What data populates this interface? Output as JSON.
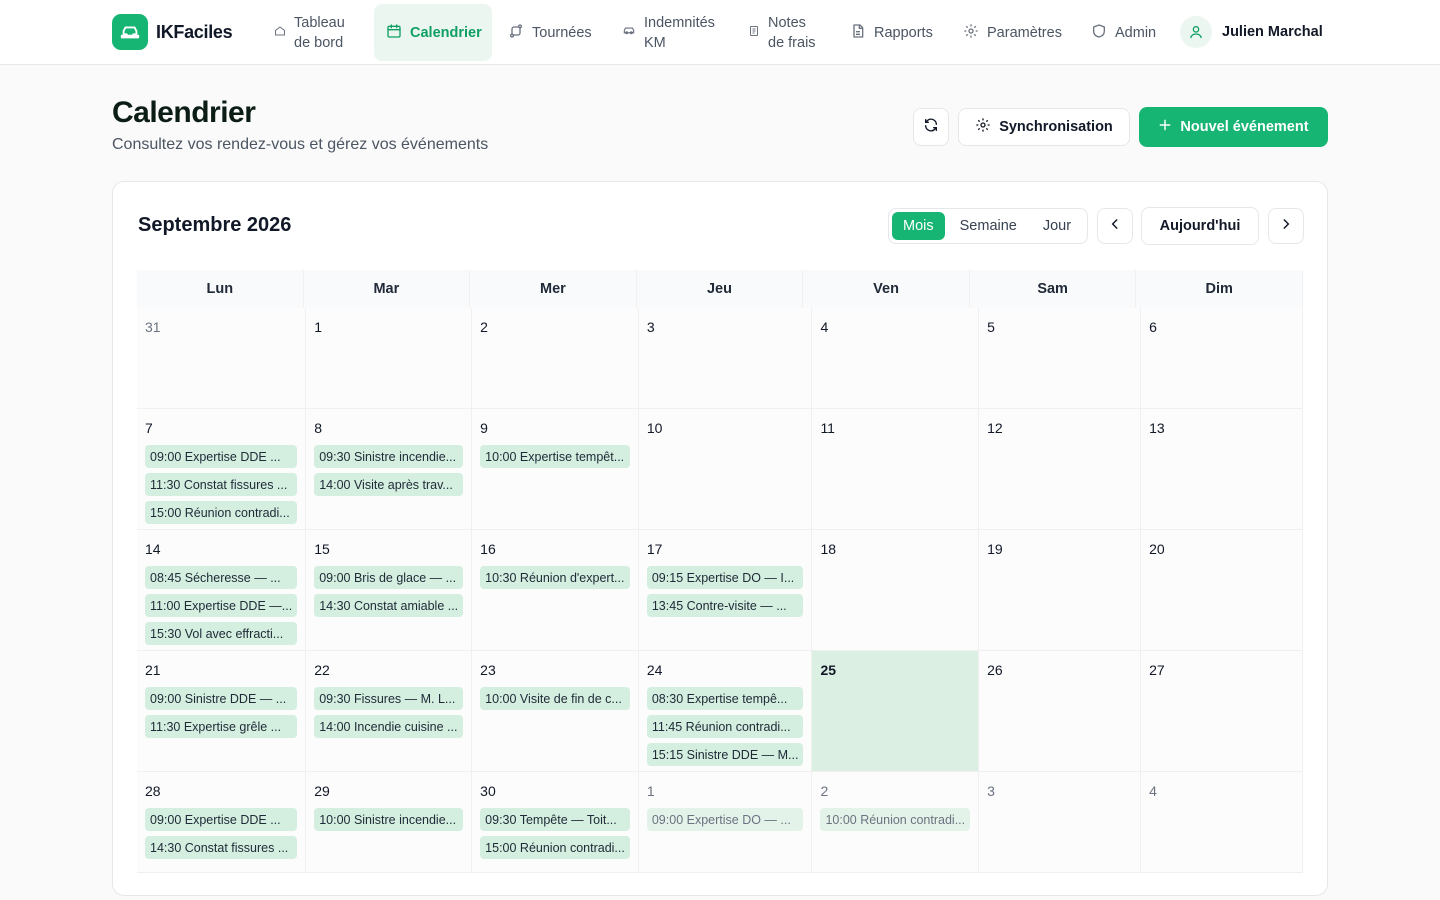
{
  "app": {
    "name": "IKFaciles",
    "brand_color": "#16b574"
  },
  "nav": {
    "items": [
      {
        "label": "Tableau\nde bord",
        "icon": "home-icon"
      },
      {
        "label": "Calendrier",
        "icon": "calendar-icon",
        "active": true
      },
      {
        "label": "Tournées",
        "icon": "route-icon"
      },
      {
        "label": "Indemnités\nKM",
        "icon": "car-icon"
      },
      {
        "label": "Notes\nde frais",
        "icon": "receipt-icon"
      },
      {
        "label": "Rapports",
        "icon": "file-icon"
      },
      {
        "label": "Paramètres",
        "icon": "gear-icon"
      },
      {
        "label": "Admin",
        "icon": "shield-icon"
      }
    ],
    "user_name": "Julien Marchal"
  },
  "header": {
    "title": "Calendrier",
    "subtitle": "Consultez vos rendez-vous et gérez vos événements",
    "sync_label": "Synchronisation",
    "new_event_label": "Nouvel événement"
  },
  "calendar": {
    "month_label": "Septembre 2026",
    "views": [
      "Mois",
      "Semaine",
      "Jour"
    ],
    "active_view": "Mois",
    "today_label": "Aujourd'hui",
    "weekdays": [
      "Lun",
      "Mar",
      "Mer",
      "Jeu",
      "Ven",
      "Sam",
      "Dim"
    ],
    "weeks": [
      [
        {
          "day": "31",
          "outside": true,
          "events": []
        },
        {
          "day": "1",
          "events": []
        },
        {
          "day": "2",
          "events": []
        },
        {
          "day": "3",
          "events": []
        },
        {
          "day": "4",
          "events": []
        },
        {
          "day": "5",
          "events": []
        },
        {
          "day": "6",
          "events": []
        }
      ],
      [
        {
          "day": "7",
          "events": [
            "09:00 Expertise DDE ...",
            "11:30 Constat fissures ...",
            "15:00 Réunion contradi..."
          ]
        },
        {
          "day": "8",
          "events": [
            "09:30 Sinistre incendie...",
            "14:00 Visite après trav..."
          ]
        },
        {
          "day": "9",
          "events": [
            "10:00 Expertise tempêt..."
          ]
        },
        {
          "day": "10",
          "events": []
        },
        {
          "day": "11",
          "events": []
        },
        {
          "day": "12",
          "events": []
        },
        {
          "day": "13",
          "events": []
        }
      ],
      [
        {
          "day": "14",
          "events": [
            "08:45 Sécheresse — ...",
            "11:00 Expertise DDE —...",
            "15:30 Vol avec effracti..."
          ]
        },
        {
          "day": "15",
          "events": [
            "09:00 Bris de glace — ...",
            "14:30 Constat amiable ..."
          ]
        },
        {
          "day": "16",
          "events": [
            "10:30 Réunion d'expert..."
          ]
        },
        {
          "day": "17",
          "events": [
            "09:15 Expertise DO — I...",
            "13:45 Contre-visite — ..."
          ]
        },
        {
          "day": "18",
          "events": []
        },
        {
          "day": "19",
          "events": []
        },
        {
          "day": "20",
          "events": []
        }
      ],
      [
        {
          "day": "21",
          "events": [
            "09:00 Sinistre DDE — ...",
            "11:30 Expertise grêle ..."
          ]
        },
        {
          "day": "22",
          "events": [
            "09:30 Fissures — M. L...",
            "14:00 Incendie cuisine ..."
          ]
        },
        {
          "day": "23",
          "events": [
            "10:00 Visite de fin de c..."
          ]
        },
        {
          "day": "24",
          "events": [
            "08:30 Expertise tempê...",
            "11:45 Réunion contradi...",
            "15:15 Sinistre DDE — M..."
          ]
        },
        {
          "day": "25",
          "today": true,
          "events": []
        },
        {
          "day": "26",
          "events": []
        },
        {
          "day": "27",
          "events": []
        }
      ],
      [
        {
          "day": "28",
          "events": [
            "09:00 Expertise DDE ...",
            "14:30 Constat fissures ..."
          ]
        },
        {
          "day": "29",
          "events": [
            "10:00 Sinistre incendie..."
          ]
        },
        {
          "day": "30",
          "events": [
            "09:30 Tempête — Toit...",
            "15:00 Réunion contradi..."
          ]
        },
        {
          "day": "1",
          "outside": true,
          "events": [
            "09:00 Expertise DO — ..."
          ]
        },
        {
          "day": "2",
          "outside": true,
          "events": [
            "10:00 Réunion contradi..."
          ]
        },
        {
          "day": "3",
          "outside": true,
          "events": []
        },
        {
          "day": "4",
          "outside": true,
          "events": []
        }
      ]
    ]
  }
}
